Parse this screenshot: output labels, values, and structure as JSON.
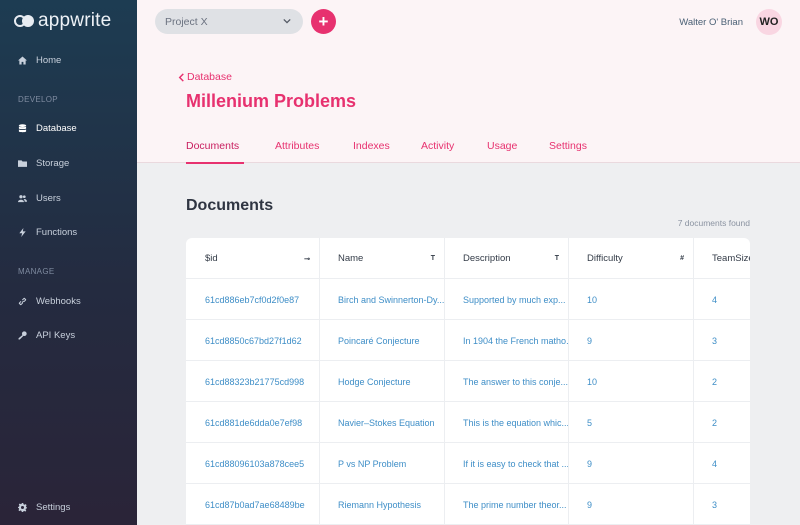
{
  "sidebar": {
    "logo_text": "appwrite",
    "sections": {
      "develop": "DEVELOP",
      "manage": "MANAGE"
    },
    "items": {
      "home": "Home",
      "database": "Database",
      "storage": "Storage",
      "users": "Users",
      "functions": "Functions",
      "webhooks": "Webhooks",
      "api_keys": "API Keys",
      "settings": "Settings"
    }
  },
  "topbar": {
    "project": "Project X",
    "add_label": "+",
    "user_name": "Walter O' Brian",
    "avatar_initials": "WO"
  },
  "header": {
    "back_label": "Database",
    "title": "Millenium Problems",
    "tabs": [
      "Documents",
      "Attributes",
      "Indexes",
      "Activity",
      "Usage",
      "Settings"
    ]
  },
  "documents": {
    "title": "Documents",
    "count_text": "7 documents found",
    "columns": [
      "$id",
      "Name",
      "Description",
      "Difficulty",
      "TeamSize"
    ],
    "column_icons": [
      "key-icon",
      "text-type-icon",
      "text-type-icon",
      "number-type-icon",
      ""
    ],
    "rows": [
      [
        "61cd886eb7cf0d2f0e87",
        "Birch and Swinnerton-Dy...",
        "Supported by much exp...",
        "10",
        "4"
      ],
      [
        "61cd8850c67bd27f1d62",
        "Poincaré Conjecture",
        "In 1904 the French matho...",
        "9",
        "3"
      ],
      [
        "61cd88323b21775cd998",
        "Hodge Conjecture",
        "The answer to this conje...",
        "10",
        "2"
      ],
      [
        "61cd881de6dda0e7ef98",
        "Navier–Stokes Equation",
        "This is the equation whic...",
        "5",
        "2"
      ],
      [
        "61cd88096103a878cee5",
        "P vs NP Problem",
        "If it is easy to check that ...",
        "9",
        "4"
      ],
      [
        "61cd87b0ad7ae68489be",
        "Riemann Hypothesis",
        "The prime number theor...",
        "9",
        "3"
      ]
    ]
  }
}
